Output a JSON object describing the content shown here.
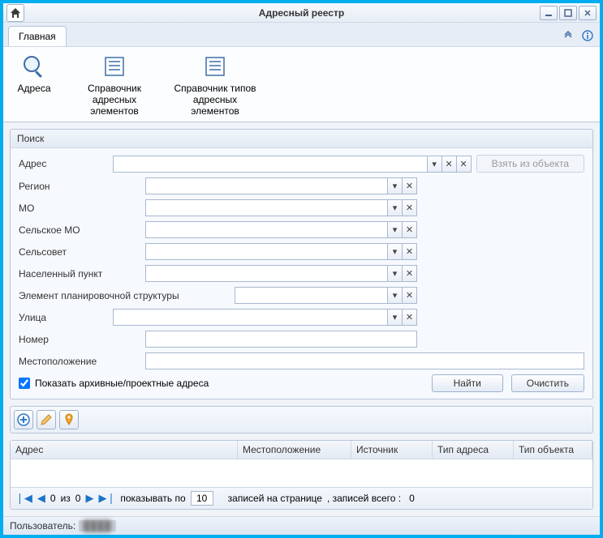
{
  "title": "Адресный реестр",
  "tab_main": "Главная",
  "ribbon": {
    "addresses": "Адреса",
    "ref_elements": "Справочник адресных элементов",
    "ref_types": "Справочник типов адресных элементов"
  },
  "search": {
    "panel_title": "Поиск",
    "address": "Адрес",
    "take_from_object": "Взять из объекта",
    "region": "Регион",
    "mo": "МО",
    "rural_mo": "Сельское МО",
    "selsovet": "Сельсовет",
    "settlement": "Населенный пункт",
    "planning_element": "Элемент планировочной структуры",
    "street": "Улица",
    "number": "Номер",
    "location": "Местоположение",
    "show_archive": "Показать архивные/проектные адреса",
    "find": "Найти",
    "clear": "Очистить"
  },
  "grid": {
    "col_address": "Адрес",
    "col_location": "Местоположение",
    "col_source": "Источник",
    "col_addr_type": "Тип адреса",
    "col_obj_type": "Тип объекта"
  },
  "pager": {
    "page_current": "0",
    "of": "из",
    "page_total": "0",
    "show_per": "показывать по",
    "per_page": "10",
    "records_on_page": "записей на странице",
    "records_total_label": ", записей всего :",
    "records_total": "0"
  },
  "status": {
    "user_label": "Пользователь:",
    "user_value": "████"
  }
}
